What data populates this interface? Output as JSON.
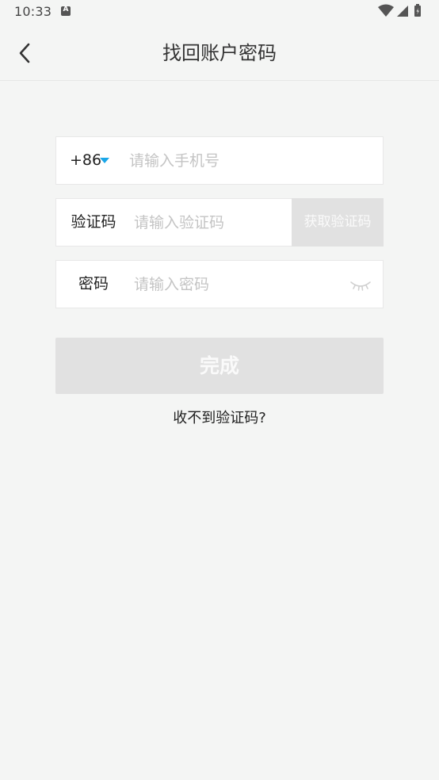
{
  "status_bar": {
    "time": "10:33",
    "icons": [
      "text-a-icon",
      "wifi-icon",
      "signal-icon",
      "battery-icon"
    ]
  },
  "header": {
    "title": "找回账户密码",
    "back_icon": "chevron-left-icon"
  },
  "form": {
    "phone": {
      "country_code": "+86",
      "dropdown_icon": "triangle-down-icon",
      "placeholder": "请输入手机号",
      "value": ""
    },
    "code": {
      "label": "验证码",
      "placeholder": "请输入验证码",
      "value": "",
      "get_code_label": "获取验证码"
    },
    "password": {
      "label": "密码",
      "placeholder": "请输入密码",
      "value": "",
      "toggle_icon": "eye-closed-icon"
    }
  },
  "actions": {
    "submit_label": "完成",
    "no_code_label": "收不到验证码?"
  },
  "colors": {
    "background": "#f4f5f4",
    "accent": "#1aa6e8",
    "disabled_button": "#e1e1e1",
    "placeholder": "#c4c4c4"
  }
}
